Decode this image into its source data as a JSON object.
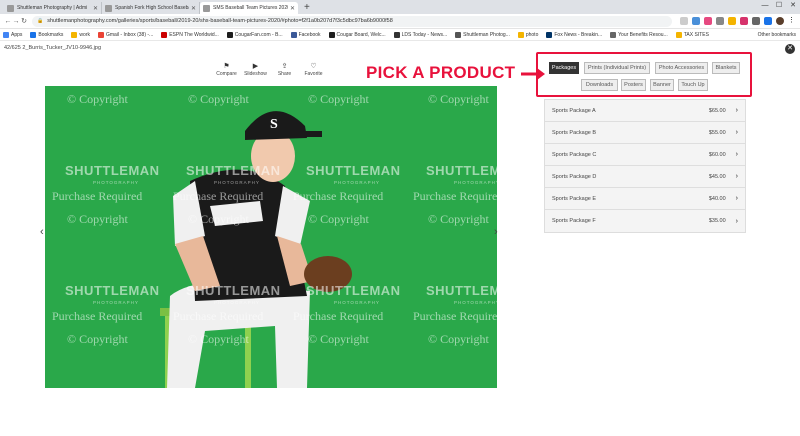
{
  "browser": {
    "tabs": [
      {
        "label": "Shuttleman Photography | Admi",
        "active": false
      },
      {
        "label": "Spanish Fork High School Baseball",
        "active": false
      },
      {
        "label": "SMS Baseball Team Pictures 2020",
        "active": true
      }
    ],
    "url": "shuttlemanphotography.com/galleries/sports/baseball/2019-20/shs-baseball-team-pictures-2020/#photo=f2f1a0b207d7f3c5dbc97ba6b9000f58",
    "bookmarks": [
      {
        "label": "Apps",
        "color": "#4285f4"
      },
      {
        "label": "Bookmarks",
        "color": "#1a73e8"
      },
      {
        "label": "work",
        "color": "#f4b400"
      },
      {
        "label": "Gmail - Inbox (38) -...",
        "color": "#ea4335"
      },
      {
        "label": "ESPN The Worldwid...",
        "color": "#cc0000"
      },
      {
        "label": "CougarFan.com - B...",
        "color": "#1d1d1d"
      },
      {
        "label": "Facebook",
        "color": "#3b5998"
      },
      {
        "label": "Cougar Board, Welc...",
        "color": "#1d1d1d"
      },
      {
        "label": "LDS Today - News...",
        "color": "#333"
      },
      {
        "label": "Shuttleman Photog...",
        "color": "#555"
      },
      {
        "label": "photo",
        "color": "#f4b400"
      },
      {
        "label": "Fox News - Breakin...",
        "color": "#003366"
      },
      {
        "label": "Your Benefits Resou...",
        "color": "#666"
      },
      {
        "label": "TAX SITES",
        "color": "#f4b400"
      }
    ],
    "other_bookmarks": "Other bookmarks"
  },
  "gallery": {
    "filename": "42/625  2_Burris_Tucker_JV10-9946.jpg",
    "actions": [
      {
        "label": "Compare",
        "icon": "flag-icon",
        "glyph": "⚑"
      },
      {
        "label": "Slideshow",
        "icon": "play-icon",
        "glyph": "▶"
      },
      {
        "label": "Share",
        "icon": "share-icon",
        "glyph": "⇪"
      },
      {
        "label": "Favorite",
        "icon": "heart-icon",
        "glyph": "♡"
      }
    ],
    "prev_glyph": "‹",
    "next_glyph": "›",
    "close_glyph": "✕"
  },
  "watermark": {
    "copyright": "© Copyright",
    "brand": "SHUTTLEMAN",
    "sub": "PHOTOGRAPHY",
    "purchase": "Purchase Required"
  },
  "annotation": {
    "text": "PICK A PRODUCT",
    "color": "#e8123c"
  },
  "product_tabs": [
    {
      "label": "Packages",
      "active": true
    },
    {
      "label": "Prints (Individual Prints)",
      "active": false
    },
    {
      "label": "Photo Accessories",
      "active": false
    },
    {
      "label": "Blankets",
      "active": false
    },
    {
      "label": "Downloads",
      "active": false
    },
    {
      "label": "Posters",
      "active": false
    },
    {
      "label": "Banner",
      "active": false
    },
    {
      "label": "Touch Up",
      "active": false
    }
  ],
  "packages": [
    {
      "name": "Sports Package A",
      "price": "$65.00"
    },
    {
      "name": "Sports Package B",
      "price": "$55.00"
    },
    {
      "name": "Sports Package C",
      "price": "$60.00"
    },
    {
      "name": "Sports Package D",
      "price": "$45.00"
    },
    {
      "name": "Sports Package E",
      "price": "$40.00"
    },
    {
      "name": "Sports Package F",
      "price": "$35.00"
    }
  ]
}
